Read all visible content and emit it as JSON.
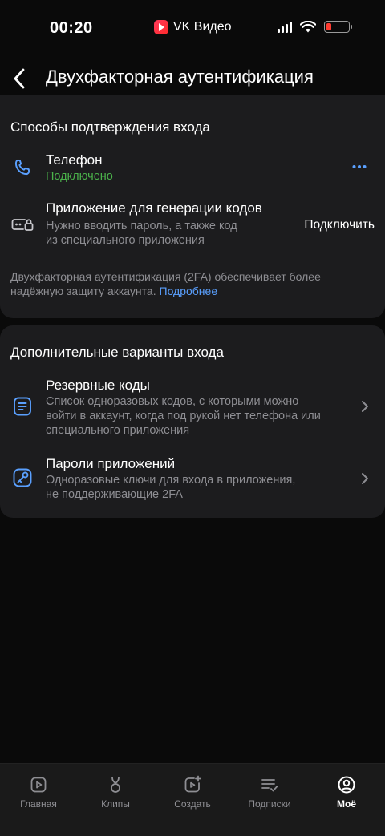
{
  "status_bar": {
    "time": "00:20",
    "app_name": "VK Видео"
  },
  "header": {
    "title": "Двухфакторная аутентификация"
  },
  "confirm_section": {
    "title": "Способы подтверждения входа",
    "phone": {
      "title": "Телефон",
      "status": "Подключено",
      "icon": "phone-icon"
    },
    "app": {
      "title": "Приложение для генерации кодов",
      "subtitle_line1": "Нужно вводить пароль, а также код",
      "subtitle_line2": "из специального приложения",
      "action": "Подключить",
      "icon": "lock-card-icon"
    },
    "footnote_text": "Двухфакторная аутентификация (2FA) обеспечивает более надёжную защиту аккаунта. ",
    "footnote_link": "Подробнее"
  },
  "extra_section": {
    "title": "Дополнительные варианты входа",
    "backup": {
      "title": "Резервные коды",
      "subtitle_line1": "Список одноразовых кодов, с которыми можно",
      "subtitle_line2": "войти в аккаунт, когда под рукой нет телефона или",
      "subtitle_line3": "специального приложения",
      "icon": "list-icon"
    },
    "app_passwords": {
      "title": "Пароли приложений",
      "subtitle_line1": "Одноразовые ключи для входа в приложения,",
      "subtitle_line2": "не поддерживающие 2FA",
      "icon": "key-icon"
    }
  },
  "tabs": [
    {
      "label": "Главная",
      "icon": "play-square-icon",
      "active": false
    },
    {
      "label": "Клипы",
      "icon": "clips-icon",
      "active": false
    },
    {
      "label": "Создать",
      "icon": "create-video-icon",
      "active": false
    },
    {
      "label": "Подписки",
      "icon": "subscriptions-icon",
      "active": false
    },
    {
      "label": "Моё",
      "icon": "profile-icon",
      "active": true
    }
  ],
  "colors": {
    "background": "#0a0a0a",
    "card": "#1c1c1e",
    "accent": "#5aa0ff",
    "success": "#4bb34b",
    "secondary_text": "#8e8e93"
  }
}
